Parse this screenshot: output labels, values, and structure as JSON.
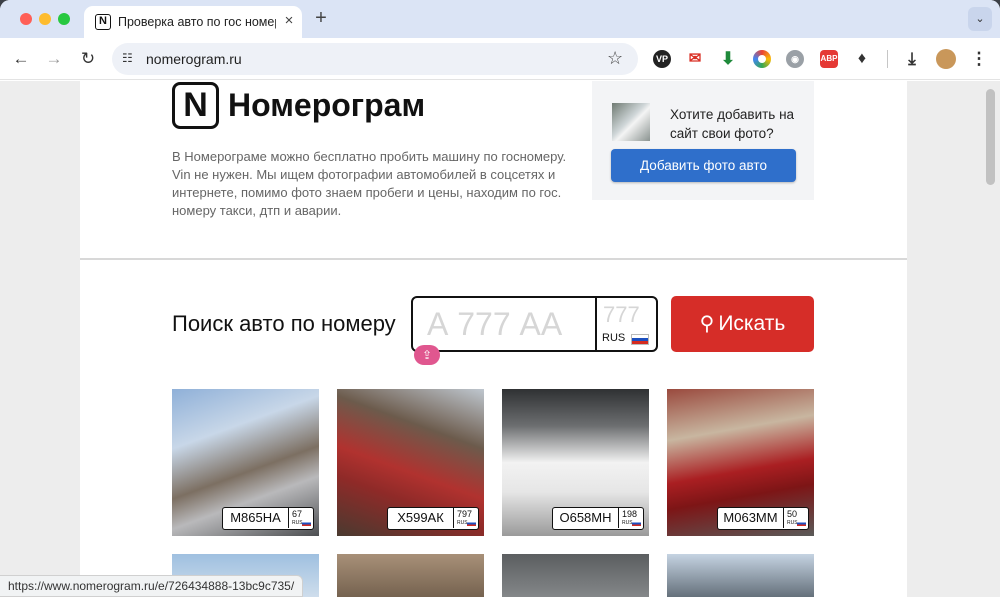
{
  "browser": {
    "tab_title": "Проверка авто по гос номер",
    "tab_favicon": "N",
    "tab_close": "×",
    "new_tab": "+",
    "tab_menu": "⌄",
    "url": "nomerogram.ru",
    "status_url": "https://www.nomerogram.ru/e/726434888-13bc9c735/",
    "icons": [
      "back-icon",
      "forward-icon",
      "reload-icon",
      "tune-icon",
      "star-icon",
      "extensions-icon",
      "download-icon",
      "avatar",
      "more-icon"
    ],
    "ext_labels": {
      "vp": "VP",
      "abp": "ABP"
    }
  },
  "header": {
    "logo_letter": "N",
    "site_title": "Номерограм",
    "intro": "В Номерограме можно бесплатно пробить машину по госномеру. Vin не нужен. Мы ищем фотографии автомобилей в соцсетях и интернете, помимо фото знаем пробеги и цены, находим по гос. номеру такси, дтп и аварии."
  },
  "promo": {
    "text": "Хотите добавить на сайт свои фото?",
    "button_label": "Добавить фото авто",
    "button_color": "#2f6fcb"
  },
  "search": {
    "label": "Поиск авто по номеру",
    "plate_placeholder": "А 777 АА",
    "region_placeholder": "777",
    "country": "RUS",
    "button_label": "Искать",
    "button_color": "#d62d28",
    "keyboard_badge_icon": "⇪"
  },
  "cars": [
    {
      "plate": "М865НА",
      "region": "67",
      "country": "RUS"
    },
    {
      "plate": "Х599АК",
      "region": "797",
      "country": "RUS"
    },
    {
      "plate": "О658МН",
      "region": "198",
      "country": "RUS"
    },
    {
      "plate": "М063ММ",
      "region": "50",
      "country": "RUS"
    }
  ]
}
